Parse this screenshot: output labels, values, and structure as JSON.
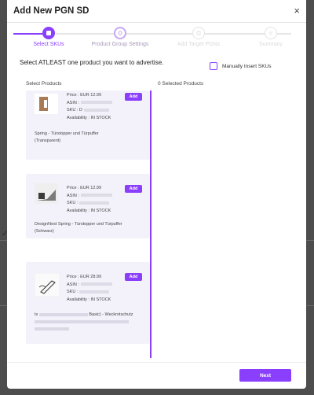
{
  "modal": {
    "title": "Add New PGN SD",
    "close_glyph": "×"
  },
  "steps": [
    {
      "label": "Select SKUs",
      "icon": "select-skus-icon",
      "state": "active"
    },
    {
      "label": "Product Group Settings",
      "icon": "settings-icon",
      "state": "current"
    },
    {
      "label": "Add Target PGNs",
      "icon": "target-icon",
      "state": "disabled"
    },
    {
      "label": "Summary",
      "icon": "summary-icon",
      "state": "disabled"
    }
  ],
  "instruction": "Select ATLEAST one product you want to advertise.",
  "manual_insert_label": "Manually Insert SKUs",
  "select_products_header": "Select Products",
  "selected_products_header": "0 Selected Products",
  "products": [
    {
      "price": "Price : EUR 12.99",
      "asin_label": "ASIN :",
      "sku_label": "SKU : D",
      "availability": "Availability : IN STOCK",
      "name_line1": "Spring - Türstopper und Türpuffer",
      "name_line2": "(Transparent)",
      "add_label": "Add"
    },
    {
      "price": "Price : EUR 12.99",
      "asin_label": "ASIN :",
      "sku_label": "SKU :",
      "availability": "Availability : IN STOCK",
      "name_line1": "DesignNest Spring - Türstopper und Türpuffer",
      "name_line2": "(Schwarz)",
      "add_label": "Add"
    },
    {
      "price": "Price : EUR 28.99",
      "asin_label": "ASIN :",
      "sku_label": "SKU :",
      "availability": "Availability : IN STOCK",
      "name_line1_prefix": "tx",
      "name_line1_suffix": "Basic) - Weckrotschutz",
      "add_label": "Add"
    }
  ],
  "next_label": "Next",
  "colors": {
    "accent": "#8a3ffc",
    "card_bg": "#f3f2fb"
  }
}
